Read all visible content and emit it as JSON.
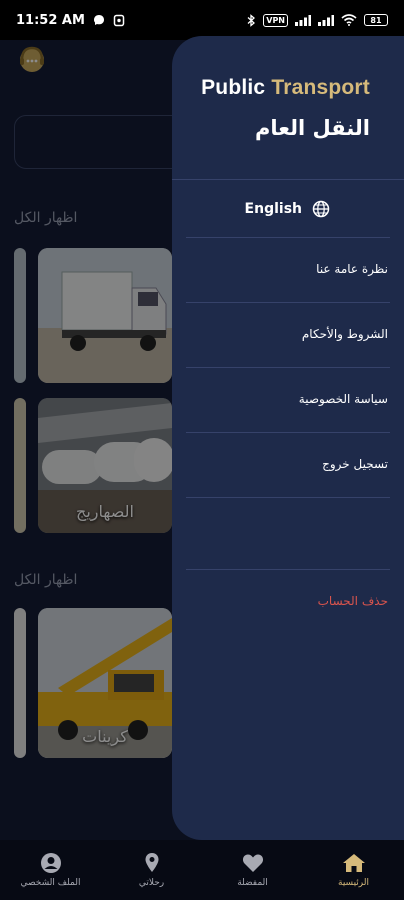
{
  "status_bar": {
    "time": "11:52 AM",
    "vpn": "VPN",
    "battery": "81"
  },
  "background": {
    "show_all_1": "اظهار الكل",
    "show_all_2": "اظهار الكل",
    "card_tankers": "الصهاريج",
    "card_cranes": "كرينات"
  },
  "drawer": {
    "title_en_1": "Public",
    "title_en_2": "Transport",
    "title_ar": "النقل العام",
    "language_label": "English",
    "menu": [
      "نظرة عامة عنا",
      "الشروط والأحكام",
      "سياسة الخصوصية",
      "تسجيل خروج"
    ],
    "delete_account": "حذف الحساب"
  },
  "bottom_nav": [
    {
      "label": "الملف الشخصي",
      "icon": "person-icon"
    },
    {
      "label": "رحلاتي",
      "icon": "location-pin-icon"
    },
    {
      "label": "المفضلة",
      "icon": "heart-icon"
    },
    {
      "label": "الرئيسية",
      "icon": "home-icon",
      "active": true
    }
  ],
  "colors": {
    "accent": "#d6ba7b",
    "drawer_bg": "#1e2a4a",
    "danger": "#d9544d"
  }
}
